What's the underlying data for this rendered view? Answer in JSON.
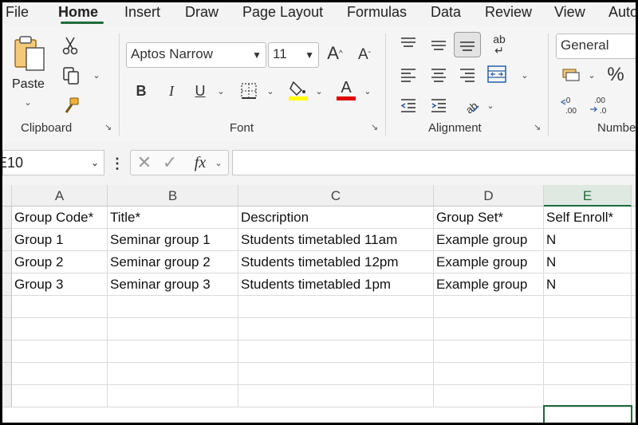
{
  "menu": {
    "tabs": [
      "File",
      "Home",
      "Insert",
      "Draw",
      "Page Layout",
      "Formulas",
      "Data",
      "Review",
      "View",
      "Auto"
    ],
    "active": "Home"
  },
  "ribbon": {
    "clipboard": {
      "paste_label": "Paste",
      "group_label": "Clipboard"
    },
    "font": {
      "font_name": "Aptos Narrow",
      "font_size": "11",
      "bold": "B",
      "italic": "I",
      "underline": "U",
      "font_color_glyph": "A",
      "grow_glyph": "A",
      "shrink_glyph": "A",
      "fill_color": "#ffff00",
      "font_color": "#e00000",
      "group_label": "Font"
    },
    "alignment": {
      "wrap_glyph": "ab",
      "group_label": "Alignment"
    },
    "number": {
      "format": "General",
      "percent": "%",
      "group_label": "Number"
    }
  },
  "formula_bar": {
    "name_box": "E10",
    "fx_label": "fx",
    "formula": ""
  },
  "sheet": {
    "columns": [
      "A",
      "B",
      "C",
      "D",
      "E"
    ],
    "selected_column": "E",
    "rows": [
      [
        "Group Code*",
        "Title*",
        "Description",
        "Group Set*",
        "Self Enroll*"
      ],
      [
        "Group 1",
        "Seminar group 1",
        "Students timetabled 11am",
        "Example group",
        "N"
      ],
      [
        "Group 2",
        "Seminar group 2",
        "Students timetabled 12pm",
        "Example group",
        "N"
      ],
      [
        "Group 3",
        "Seminar group 3",
        "Students timetabled 1pm",
        "Example group",
        "N"
      ],
      [
        "",
        "",
        "",
        "",
        ""
      ],
      [
        "",
        "",
        "",
        "",
        ""
      ],
      [
        "",
        "",
        "",
        "",
        ""
      ],
      [
        "",
        "",
        "",
        "",
        ""
      ],
      [
        "",
        "",
        "",
        "",
        ""
      ]
    ]
  },
  "colors": {
    "accent": "#1e6b3a"
  }
}
